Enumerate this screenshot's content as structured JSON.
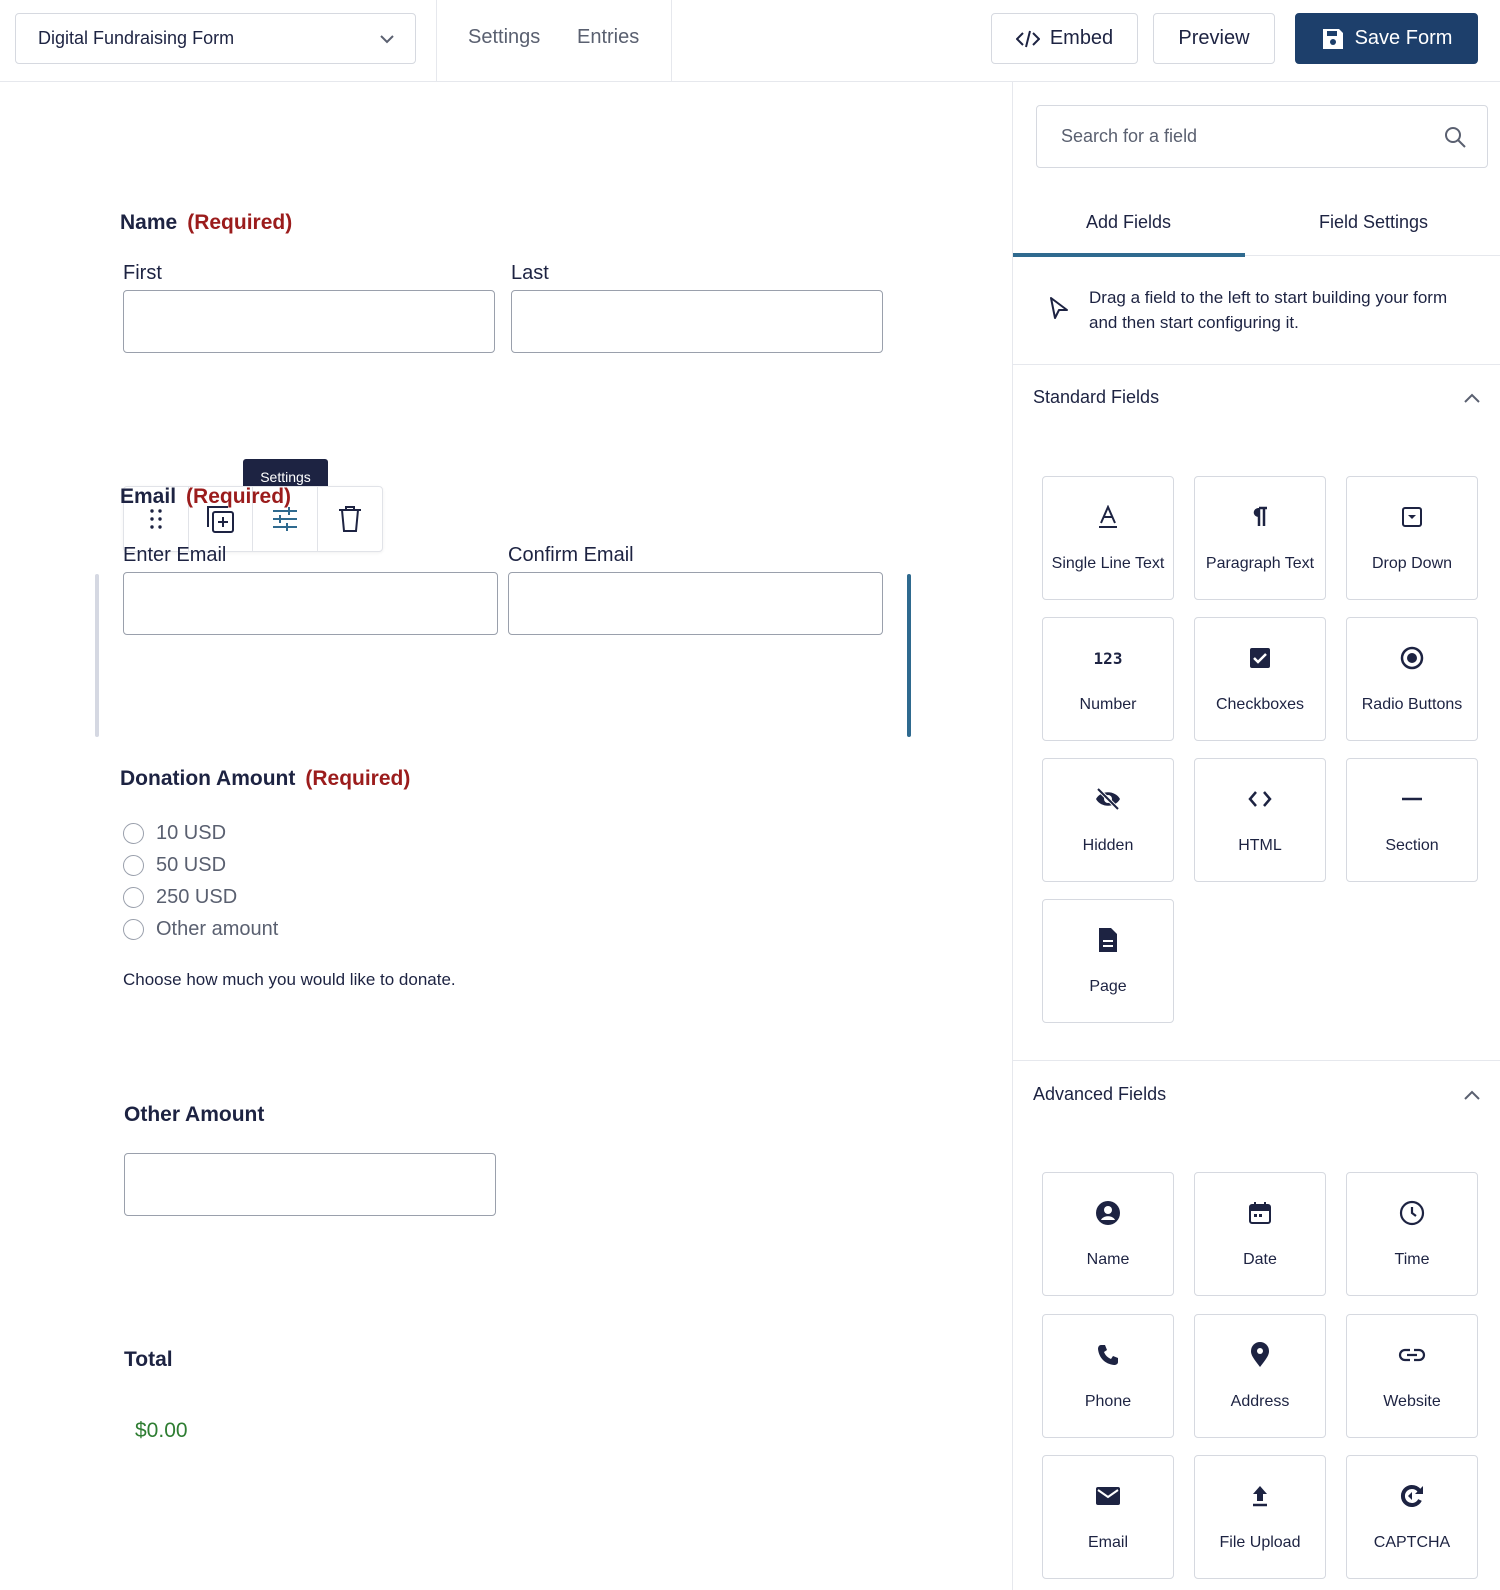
{
  "topbar": {
    "form_name": "Digital Fundraising Form",
    "links": {
      "settings": "Settings",
      "entries": "Entries"
    },
    "buttons": {
      "embed": "Embed",
      "preview": "Preview",
      "save": "Save Form"
    }
  },
  "canvas": {
    "name_field": {
      "label": "Name",
      "required": "(Required)",
      "first": "First",
      "last": "Last"
    },
    "toolbar_tooltip": "Settings",
    "email_field": {
      "label": "Email",
      "required": "(Required)",
      "enter": "Enter Email",
      "confirm": "Confirm Email"
    },
    "donation_field": {
      "label": "Donation Amount",
      "required": "(Required)",
      "options": [
        "10 USD",
        "50 USD",
        "250 USD",
        "Other amount"
      ],
      "description": "Choose how much you would like to donate."
    },
    "other_amount": {
      "label": "Other Amount"
    },
    "total": {
      "label": "Total",
      "value": "$0.00"
    }
  },
  "sidebar": {
    "search_placeholder": "Search for a field",
    "tabs": {
      "add": "Add Fields",
      "settings": "Field Settings"
    },
    "hint": "Drag a field to the left to start building your form and then start configuring it.",
    "standard": {
      "title": "Standard Fields",
      "items": [
        "Single Line Text",
        "Paragraph Text",
        "Drop Down",
        "Number",
        "Checkboxes",
        "Radio Buttons",
        "Hidden",
        "HTML",
        "Section",
        "Page"
      ]
    },
    "advanced": {
      "title": "Advanced Fields",
      "items": [
        "Name",
        "Date",
        "Time",
        "Phone",
        "Address",
        "Website",
        "Email",
        "File Upload",
        "CAPTCHA"
      ]
    }
  },
  "colors": {
    "primary": "#1d3f6b",
    "required": "#9b1c1c",
    "accent": "#2f6a8f",
    "total": "#2e7d32"
  }
}
